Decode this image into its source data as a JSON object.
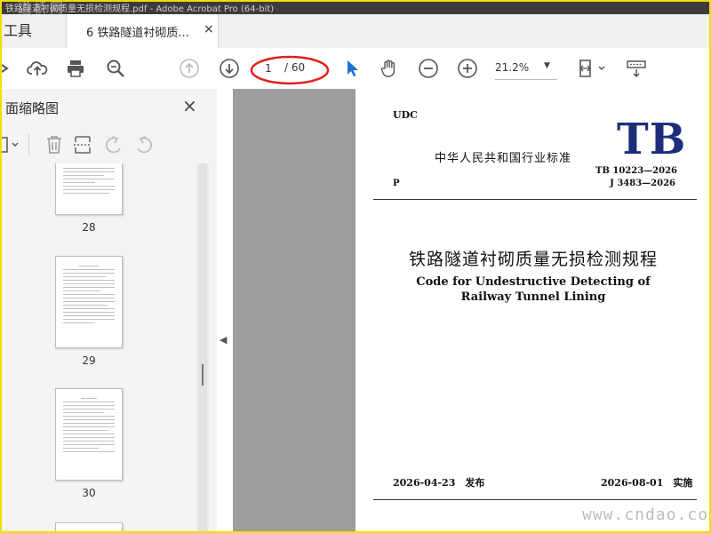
{
  "window": {
    "title": "铁路隧道衬砌质量无损检测规程.pdf - Adobe Acrobat Pro (64-bit)",
    "watermark": "道桥网"
  },
  "tabs": {
    "tools_label": "工具",
    "doc_label": "6 铁路隧道衬砌质...",
    "close_glyph": "×"
  },
  "toolbar": {
    "page_current": "1",
    "page_total": "/ 60",
    "zoom": "21.2%",
    "zoom_caret": "▼",
    "highlight_color": "#e0201b"
  },
  "sidebar": {
    "title": "面缩略图",
    "close_glyph": "×",
    "thumbnails": [
      {
        "page": "28"
      },
      {
        "page": "29"
      },
      {
        "page": "30"
      }
    ]
  },
  "document": {
    "udc": "UDC",
    "org": "中华人民共和国行业标准",
    "logo": "TB",
    "code1": "TB 10223—2026",
    "code2": "J 3483—2026",
    "p": "P",
    "title_cn": "铁路隧道衬砌质量无损检测规程",
    "title_en_line1": "Code for Undestructive Detecting of",
    "title_en_line2": "Railway Tunnel Lining",
    "issue": "2026-04-23　发布",
    "implement": "2026-08-01　实施",
    "footer_watermark": "www.cndao.com",
    "logo_color": "#1d2d7a"
  },
  "colors": {
    "frame": "#f0e000",
    "cursor_blue": "#1c6fd6"
  }
}
